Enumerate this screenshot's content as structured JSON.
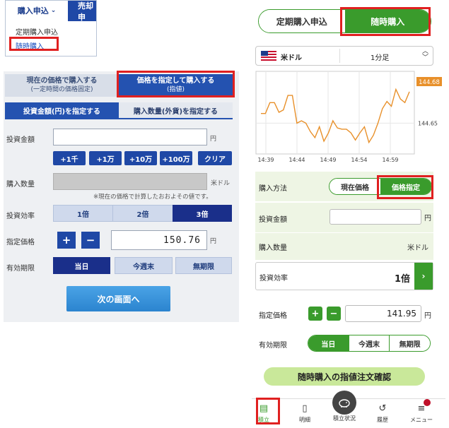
{
  "left_menu": {
    "tab_purchase": "購入申込",
    "tab_sell": "売却申",
    "items": [
      "定期購入申込",
      "随時購入"
    ]
  },
  "left_form": {
    "mode_tabs": [
      {
        "label": "現在の価格で購入する",
        "sub": "(一定時間の価格固定)"
      },
      {
        "label": "価格を指定して購入する",
        "sub": "(指値)"
      }
    ],
    "sub_tabs": [
      "投資金額(円)を指定する",
      "購入数量(外貨)を指定する"
    ],
    "investment_label": "投資金額",
    "investment_value": "",
    "yen_unit": "円",
    "quick_buttons": [
      "+1千",
      "+1万",
      "+10万",
      "+100万",
      "クリア"
    ],
    "quantity_label": "購入数量",
    "quantity_unit": "米ドル",
    "quantity_note": "※現在の価格で計算したおおよその値です。",
    "leverage_label": "投資効率",
    "leverage_options": [
      "1倍",
      "2倍",
      "3倍"
    ],
    "price_label": "指定価格",
    "plus": "+",
    "minus": "−",
    "price_value": "150.76",
    "price_unit": "円",
    "expiry_label": "有効期限",
    "expiry_options": [
      "当日",
      "今週末",
      "無期限"
    ],
    "next_button": "次の画面へ"
  },
  "right_app": {
    "top_tabs": [
      "定期購入申込",
      "随時購入"
    ],
    "currency": "米ドル",
    "interval": "1分足",
    "chart_data": {
      "type": "line",
      "x_ticks": [
        "14:39",
        "14:44",
        "14:49",
        "14:54",
        "14:59"
      ],
      "y_ticks": [
        "144.65"
      ],
      "current_label": "144.68",
      "values": [
        144.658,
        144.658,
        144.667,
        144.667,
        144.659,
        144.661,
        144.673,
        144.673,
        144.65,
        144.652,
        144.65,
        144.643,
        144.638,
        144.647,
        144.635,
        144.642,
        144.652,
        144.646,
        144.645,
        144.645,
        144.642,
        144.636,
        144.642,
        144.647,
        144.634,
        144.64,
        144.65,
        144.662,
        144.668,
        144.664,
        144.678,
        144.67,
        144.667,
        144.676
      ],
      "ylim": [
        144.628,
        144.69
      ]
    },
    "method_label": "購入方法",
    "method_options": [
      "現在価格",
      "価格指定"
    ],
    "investment_label": "投資金額",
    "investment_value": "",
    "yen_unit": "円",
    "quantity_label": "購入数量",
    "quantity_unit": "米ドル",
    "leverage_label": "投資効率",
    "leverage_value": "1倍",
    "arrow": "›",
    "price_label": "指定価格",
    "plus": "+",
    "minus": "−",
    "price_value": "141.95",
    "price_unit": "円",
    "expiry_label": "有効期限",
    "expiry_options": [
      "当日",
      "今週末",
      "無期限"
    ],
    "confirm_button": "随時購入の指値注文確認",
    "nav": [
      "積立",
      "明細",
      "積立状況",
      "履歴",
      "メニュー"
    ]
  }
}
